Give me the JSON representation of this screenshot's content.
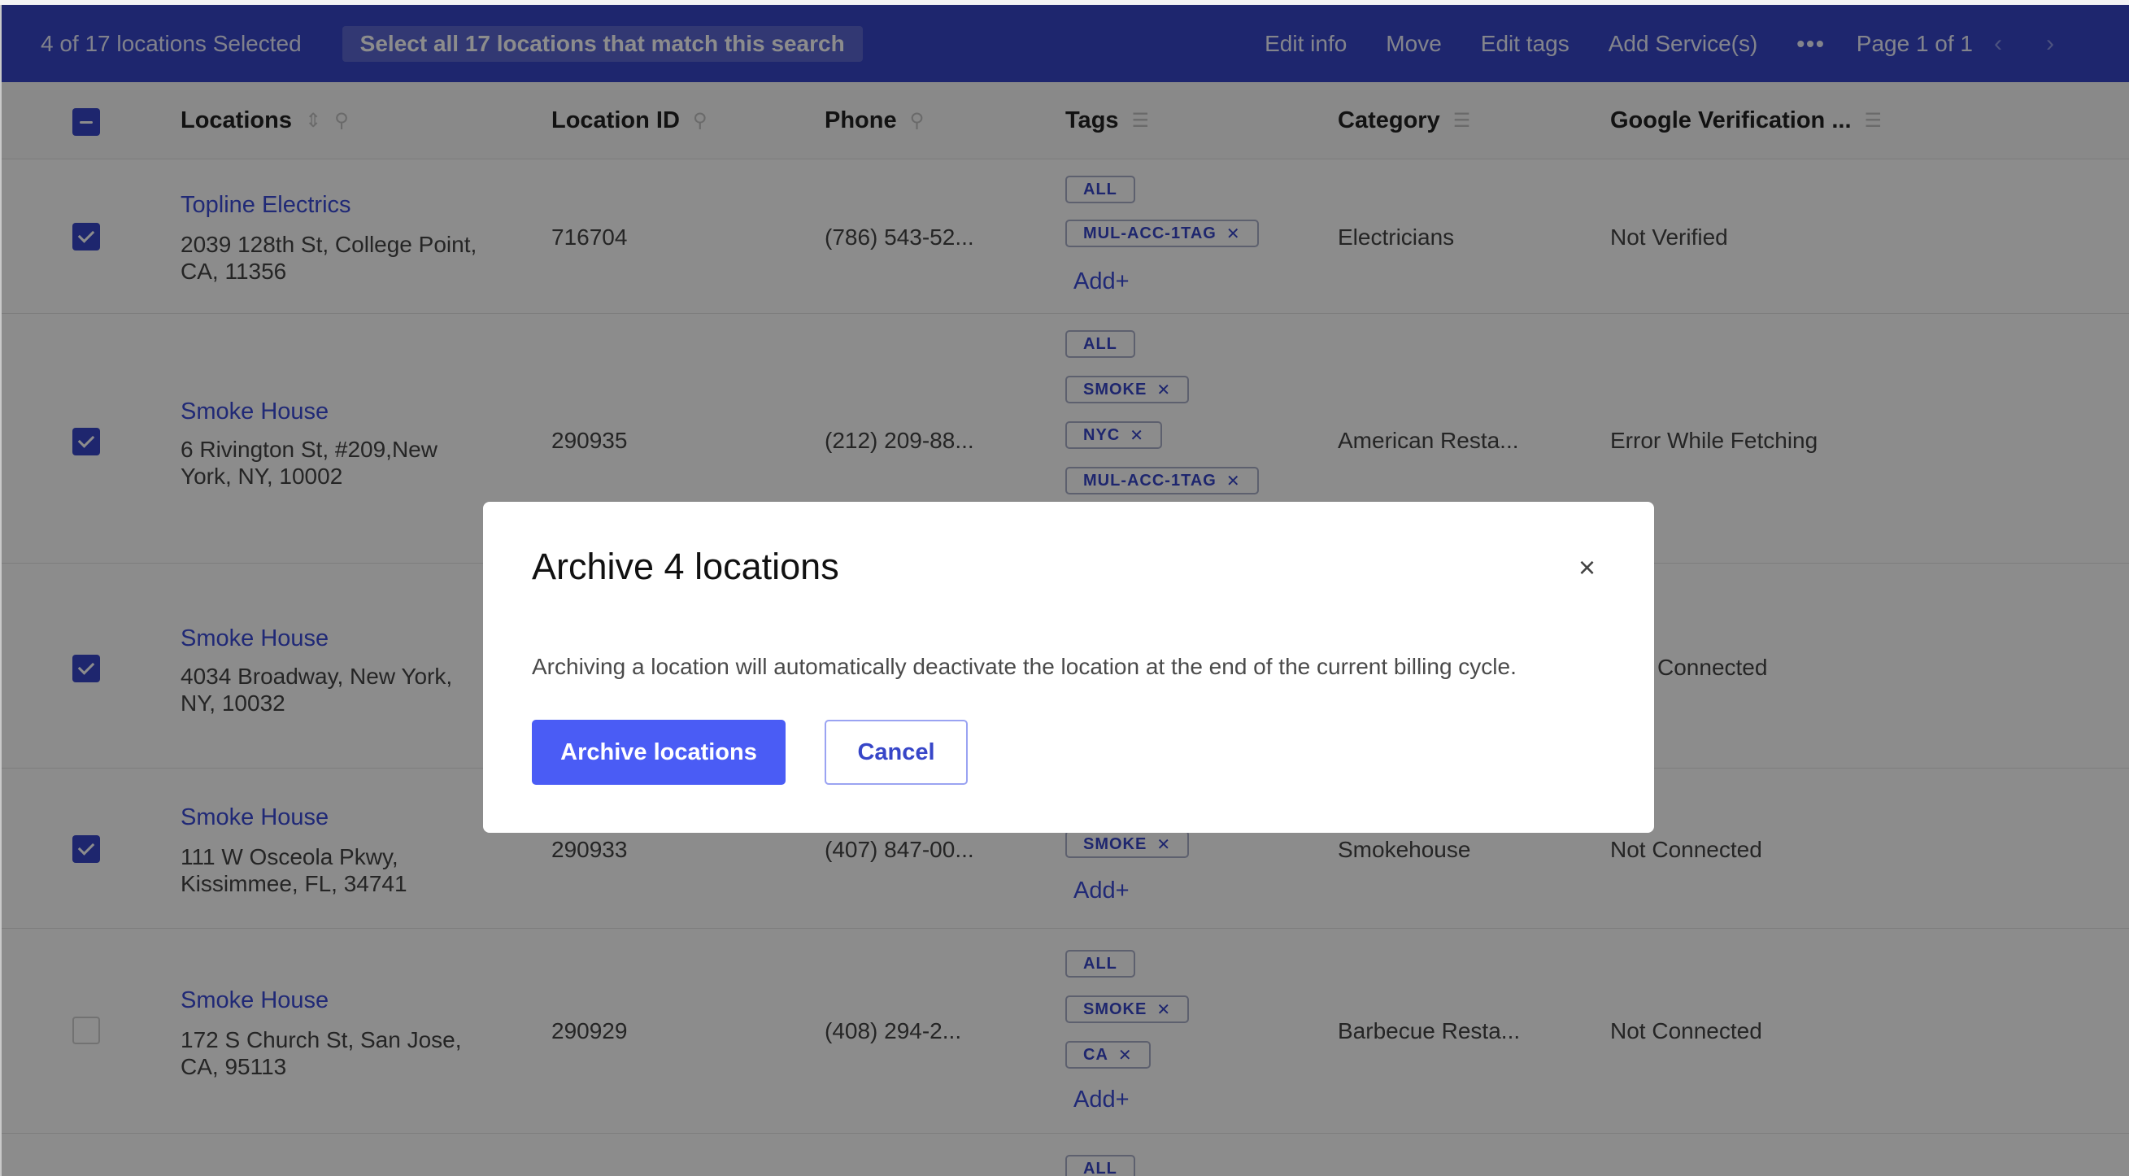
{
  "selection_bar": {
    "count_text": "4 of 17 locations Selected",
    "select_all_text": "Select all 17 locations that match this search",
    "actions": [
      "Edit info",
      "Move",
      "Edit tags",
      "Add Service(s)"
    ],
    "more": "•••",
    "page_text": "Page 1 of 1",
    "prev": "‹",
    "next": "›"
  },
  "table": {
    "headers": {
      "locations": "Locations",
      "location_id": "Location ID",
      "phone": "Phone",
      "tags": "Tags",
      "category": "Category",
      "google": "Google Verification ..."
    },
    "add_label": "Add+",
    "rows": [
      {
        "name": "Topline Electrics",
        "address": "2039 128th St, College Point, CA, 11356",
        "id": "716704",
        "phone": "(786) 543-52...",
        "tags": [
          "ALL",
          "MUL-ACC-1TAG"
        ],
        "category": "Electricians",
        "google": "Not Verified",
        "checked": true
      },
      {
        "name": "Smoke House",
        "address": "6 Rivington St, #209,New York, NY, 10002",
        "id": "290935",
        "phone": "(212) 209-88...",
        "tags": [
          "ALL",
          "SMOKE",
          "NYC",
          "MUL-ACC-1TAG"
        ],
        "category": "American Resta...",
        "google": "Error While Fetching",
        "checked": true
      },
      {
        "name": "Smoke House",
        "address": "4034 Broadway, New York, NY, 10032",
        "google": "Connected",
        "checked": true
      },
      {
        "name": "Smoke House",
        "address": "111 W Osceola Pkwy, Kissimmee, FL, 34741",
        "id": "290933",
        "phone": "(407) 847-00...",
        "tags": [
          "SMOKE"
        ],
        "category": "Smokehouse",
        "google": "Not Connected",
        "checked": true
      },
      {
        "name": "Smoke House",
        "address": "172 S Church St, San Jose, CA, 95113",
        "id": "290929",
        "phone": "(408) 294-2...",
        "tags": [
          "ALL",
          "SMOKE",
          "CA"
        ],
        "category": "Barbecue Resta...",
        "google": "Not Connected",
        "checked": false
      },
      {
        "tags": [
          "ALL"
        ]
      }
    ]
  },
  "modal": {
    "title": "Archive 4 locations",
    "close": "×",
    "body": "Archiving a location will automatically deactivate the location at the end of the current billing cycle.",
    "primary": "Archive locations",
    "secondary": "Cancel"
  },
  "colors": {
    "accent": "#3746c8",
    "primary_button": "#4a5cf5",
    "link": "#3b4bd8"
  }
}
